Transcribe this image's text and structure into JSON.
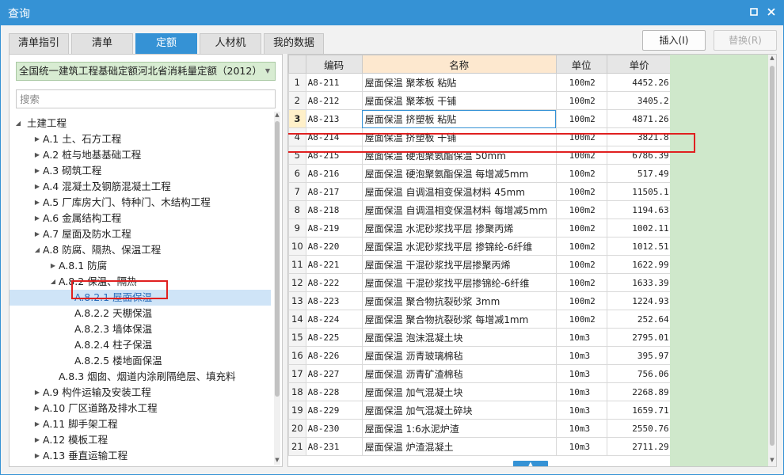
{
  "window": {
    "title": "查询",
    "max_icon": "maximize-icon",
    "close_icon": "close-icon"
  },
  "tabs": [
    {
      "label": "清单指引",
      "active": false
    },
    {
      "label": "清单",
      "active": false
    },
    {
      "label": "定额",
      "active": true
    },
    {
      "label": "人材机",
      "active": false
    },
    {
      "label": "我的数据",
      "active": false
    }
  ],
  "actions": {
    "insert": "插入(I)",
    "replace": "替换(R)"
  },
  "left": {
    "dropdown_value": "全国统一建筑工程基础定额河北省消耗量定额（2012）",
    "search_placeholder": "搜索",
    "tree": [
      {
        "label": "土建工程",
        "toggle": "expanded",
        "level": 0
      },
      {
        "label": "A.1 土、石方工程",
        "toggle": "collapsed",
        "level": 1
      },
      {
        "label": "A.2 桩与地基基础工程",
        "toggle": "collapsed",
        "level": 1
      },
      {
        "label": "A.3 砌筑工程",
        "toggle": "collapsed",
        "level": 1
      },
      {
        "label": "A.4 混凝土及钢筋混凝土工程",
        "toggle": "collapsed",
        "level": 1
      },
      {
        "label": "A.5 厂库房大门、特种门、木结构工程",
        "toggle": "collapsed",
        "level": 1
      },
      {
        "label": "A.6 金属结构工程",
        "toggle": "collapsed",
        "level": 1
      },
      {
        "label": "A.7 屋面及防水工程",
        "toggle": "collapsed",
        "level": 1
      },
      {
        "label": "A.8 防腐、隔热、保温工程",
        "toggle": "expanded",
        "level": 1
      },
      {
        "label": "A.8.1 防腐",
        "toggle": "collapsed",
        "level": 2
      },
      {
        "label": "A.8.2 保温、隔热",
        "toggle": "expanded",
        "level": 2
      },
      {
        "label": "A.8.2.1 屋面保温",
        "toggle": "none",
        "level": 3,
        "selected": true
      },
      {
        "label": "A.8.2.2 天棚保温",
        "toggle": "none",
        "level": 3
      },
      {
        "label": "A.8.2.3 墙体保温",
        "toggle": "none",
        "level": 3
      },
      {
        "label": "A.8.2.4 柱子保温",
        "toggle": "none",
        "level": 3
      },
      {
        "label": "A.8.2.5 楼地面保温",
        "toggle": "none",
        "level": 3
      },
      {
        "label": "A.8.3 烟囱、烟道内涂刷隔绝层、填充料",
        "toggle": "none",
        "level": 2
      },
      {
        "label": "A.9 构件运输及安装工程",
        "toggle": "collapsed",
        "level": 1
      },
      {
        "label": "A.10 厂区道路及排水工程",
        "toggle": "collapsed",
        "level": 1
      },
      {
        "label": "A.11 脚手架工程",
        "toggle": "collapsed",
        "level": 1
      },
      {
        "label": "A.12 模板工程",
        "toggle": "collapsed",
        "level": 1
      },
      {
        "label": "A.13 垂直运输工程",
        "toggle": "collapsed",
        "level": 1
      }
    ]
  },
  "grid": {
    "headers": {
      "code": "编码",
      "name": "名称",
      "unit": "单位",
      "price": "单价"
    },
    "current_row": 3,
    "rows": [
      {
        "n": "1",
        "code": "A8-211",
        "name": "屋面保温 聚苯板 粘贴",
        "unit": "100m2",
        "price": "4452.26"
      },
      {
        "n": "2",
        "code": "A8-212",
        "name": "屋面保温 聚苯板 干铺",
        "unit": "100m2",
        "price": "3405.2"
      },
      {
        "n": "3",
        "code": "A8-213",
        "name": "屋面保温 挤塑板 粘贴",
        "unit": "100m2",
        "price": "4871.26"
      },
      {
        "n": "4",
        "code": "A8-214",
        "name": "屋面保温 挤塑板 干铺",
        "unit": "100m2",
        "price": "3821.8"
      },
      {
        "n": "5",
        "code": "A8-215",
        "name": "屋面保温 硬泡聚氨酯保温 50mm",
        "unit": "100m2",
        "price": "6786.39"
      },
      {
        "n": "6",
        "code": "A8-216",
        "name": "屋面保温 硬泡聚氨酯保温 每增减5mm",
        "unit": "100m2",
        "price": "517.49"
      },
      {
        "n": "7",
        "code": "A8-217",
        "name": "屋面保温 自调温相变保温材料 45mm",
        "unit": "100m2",
        "price": "11505.1"
      },
      {
        "n": "8",
        "code": "A8-218",
        "name": "屋面保温 自调温相变保温材料 每增减5mm",
        "unit": "100m2",
        "price": "1194.63"
      },
      {
        "n": "9",
        "code": "A8-219",
        "name": "屋面保温 水泥砂浆找平层 掺聚丙烯",
        "unit": "100m2",
        "price": "1002.11"
      },
      {
        "n": "10",
        "code": "A8-220",
        "name": "屋面保温 水泥砂浆找平层 掺锦纶-6纤维",
        "unit": "100m2",
        "price": "1012.51"
      },
      {
        "n": "11",
        "code": "A8-221",
        "name": "屋面保温 干混砂浆找平层掺聚丙烯",
        "unit": "100m2",
        "price": "1622.99"
      },
      {
        "n": "12",
        "code": "A8-222",
        "name": "屋面保温 干混砂浆找平层掺锦纶-6纤维",
        "unit": "100m2",
        "price": "1633.39"
      },
      {
        "n": "13",
        "code": "A8-223",
        "name": "屋面保温 聚合物抗裂砂浆 3mm",
        "unit": "100m2",
        "price": "1224.93"
      },
      {
        "n": "14",
        "code": "A8-224",
        "name": "屋面保温 聚合物抗裂砂浆 每增减1mm",
        "unit": "100m2",
        "price": "252.64"
      },
      {
        "n": "15",
        "code": "A8-225",
        "name": "屋面保温 泡沫混凝土块",
        "unit": "10m3",
        "price": "2795.01"
      },
      {
        "n": "16",
        "code": "A8-226",
        "name": "屋面保温 沥青玻璃棉毡",
        "unit": "10m3",
        "price": "395.97"
      },
      {
        "n": "17",
        "code": "A8-227",
        "name": "屋面保温 沥青矿渣棉毡",
        "unit": "10m3",
        "price": "756.06"
      },
      {
        "n": "18",
        "code": "A8-228",
        "name": "屋面保温 加气混凝土块",
        "unit": "10m3",
        "price": "2268.89"
      },
      {
        "n": "19",
        "code": "A8-229",
        "name": "屋面保温 加气混凝土碎块",
        "unit": "10m3",
        "price": "1659.71"
      },
      {
        "n": "20",
        "code": "A8-230",
        "name": "屋面保温 1:6水泥炉渣",
        "unit": "10m3",
        "price": "2550.76"
      },
      {
        "n": "21",
        "code": "A8-231",
        "name": "屋面保温 炉渣混凝土",
        "unit": "10m3",
        "price": "2711.29"
      }
    ]
  },
  "colors": {
    "accent": "#3592d5",
    "highlight_box": "#e02020",
    "dropdown_bg": "#d8ecd2",
    "grid_side_strip": "#cfe8cb"
  }
}
